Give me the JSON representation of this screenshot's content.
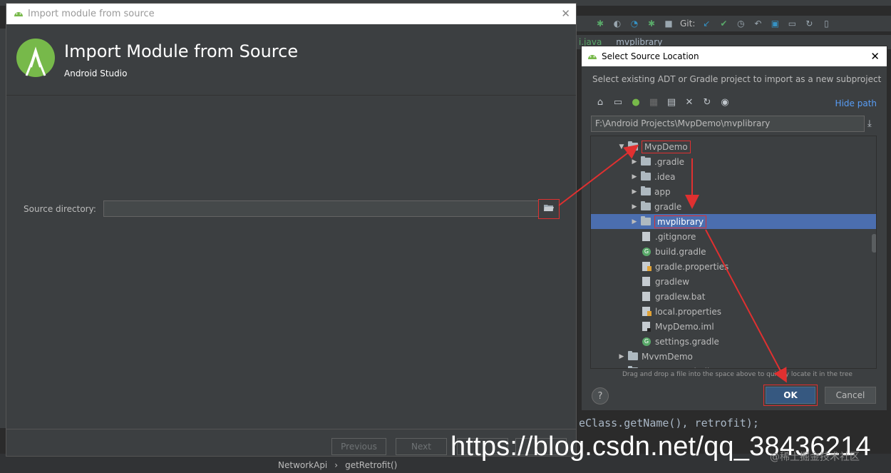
{
  "ide": {
    "toolbar_git_label": "Git:",
    "tabs": [
      "i.java",
      "mvplibrary"
    ],
    "code_line": "eClass.getName(), retrofit);",
    "breadcrumb": [
      "NetworkApi",
      "getRetrofit()"
    ],
    "watermark": "https://blog.csdn.net/qq_38436214",
    "watermark_small": "@稀土掘金技术社区"
  },
  "import_dialog": {
    "window_title": "Import module from source",
    "title": "Import Module from Source",
    "subtitle": "Android Studio",
    "source_label": "Source directory:",
    "source_value": "",
    "footer": {
      "previous": "Previous",
      "next": "Next",
      "finish": "",
      "cancel": ""
    }
  },
  "select_dialog": {
    "window_title": "Select Source Location",
    "description": "Select existing ADT or Gradle project to import as a new subproject",
    "hide_path": "Hide path",
    "path": "F:\\Android Projects\\MvpDemo\\mvplibrary",
    "tree": [
      {
        "label": "MvpDemo",
        "type": "folder",
        "level": 0,
        "expanded": true,
        "highlight": true
      },
      {
        "label": ".gradle",
        "type": "folder",
        "level": 1,
        "expanded": false
      },
      {
        "label": ".idea",
        "type": "folder",
        "level": 1,
        "expanded": false
      },
      {
        "label": "app",
        "type": "folder",
        "level": 1,
        "expanded": false
      },
      {
        "label": "gradle",
        "type": "folder",
        "level": 1,
        "expanded": false
      },
      {
        "label": "mvplibrary",
        "type": "folder",
        "level": 1,
        "expanded": false,
        "selected": true,
        "highlight": true
      },
      {
        "label": ".gitignore",
        "type": "file",
        "level": 1
      },
      {
        "label": "build.gradle",
        "type": "gradle",
        "level": 1
      },
      {
        "label": "gradle.properties",
        "type": "properties",
        "level": 1
      },
      {
        "label": "gradlew",
        "type": "file",
        "level": 1
      },
      {
        "label": "gradlew.bat",
        "type": "file",
        "level": 1
      },
      {
        "label": "local.properties",
        "type": "properties",
        "level": 1
      },
      {
        "label": "MvpDemo.iml",
        "type": "iml",
        "level": 1
      },
      {
        "label": "settings.gradle",
        "type": "gradle",
        "level": 1
      },
      {
        "label": "MvvmDemo",
        "type": "folder",
        "level": 0,
        "expanded": false
      },
      {
        "label": "MvvmJetpackAll",
        "type": "folder",
        "level": 0,
        "expanded": false
      }
    ],
    "drag_hint": "Drag and drop a file into the space above to quickly locate it in the tree",
    "ok": "OK",
    "cancel": "Cancel",
    "help": "?"
  },
  "colors": {
    "annotation": "#e03030",
    "selection": "#4b6eaf",
    "android_green": "#77b94a"
  }
}
